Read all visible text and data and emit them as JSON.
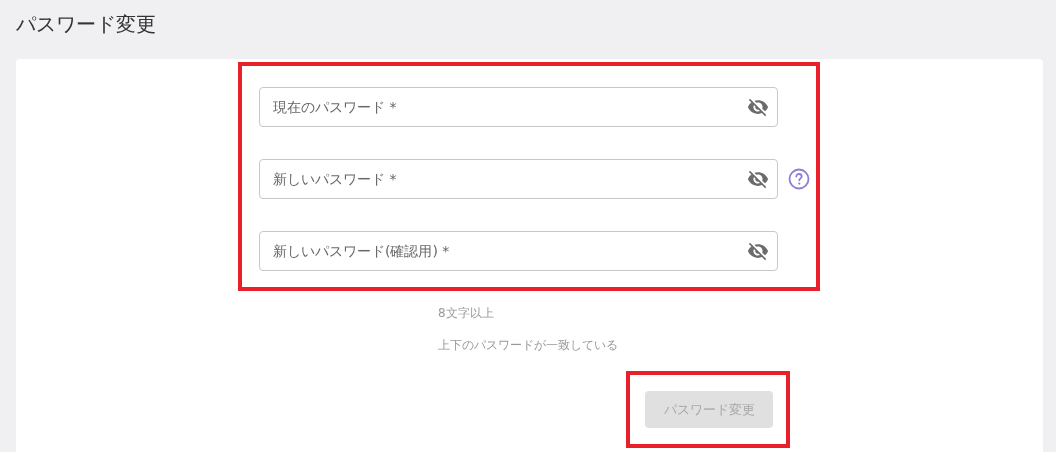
{
  "page_title": "パスワード変更",
  "form": {
    "highlighted": true,
    "fields": [
      {
        "placeholder": "現在のパスワード *",
        "password_hidden": true,
        "help": false
      },
      {
        "placeholder": "新しいパスワード *",
        "password_hidden": true,
        "help": true
      },
      {
        "placeholder": "新しいパスワード(確認用) *",
        "password_hidden": true,
        "help": false
      }
    ]
  },
  "rules": [
    {
      "text": "8文字以上",
      "met": false
    },
    {
      "text": "上下のパスワードが一致している",
      "met": false
    }
  ],
  "submit_button": {
    "label": "パスワード変更",
    "disabled": true,
    "highlighted": true
  }
}
